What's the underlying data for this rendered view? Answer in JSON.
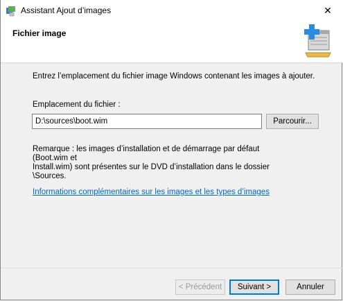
{
  "window": {
    "title": "Assistant Ajout d’images",
    "close_glyph": "✕"
  },
  "header": {
    "title": "Fichier image",
    "icon": "image-add-icon"
  },
  "main": {
    "intro": "Entrez l’emplacement du fichier image Windows contenant les images à ajouter.",
    "location_label": "Emplacement du fichier :",
    "location_value": "D:\\sources\\boot.wim",
    "browse_label": "Parcourir...",
    "note_line1": "Remarque : les images d’installation et de démarrage par défaut (Boot.wim et",
    "note_line2": "Install.wim) sont présentes sur le DVD d’installation dans le dossier \\Sources.",
    "info_link": "Informations complémentaires sur les images et les types d’images"
  },
  "footer": {
    "prev_label": "< Précédent",
    "next_label": "Suivant >",
    "cancel_label": "Annuler"
  },
  "colors": {
    "accent": "#0078d7",
    "link": "#0066cc"
  }
}
